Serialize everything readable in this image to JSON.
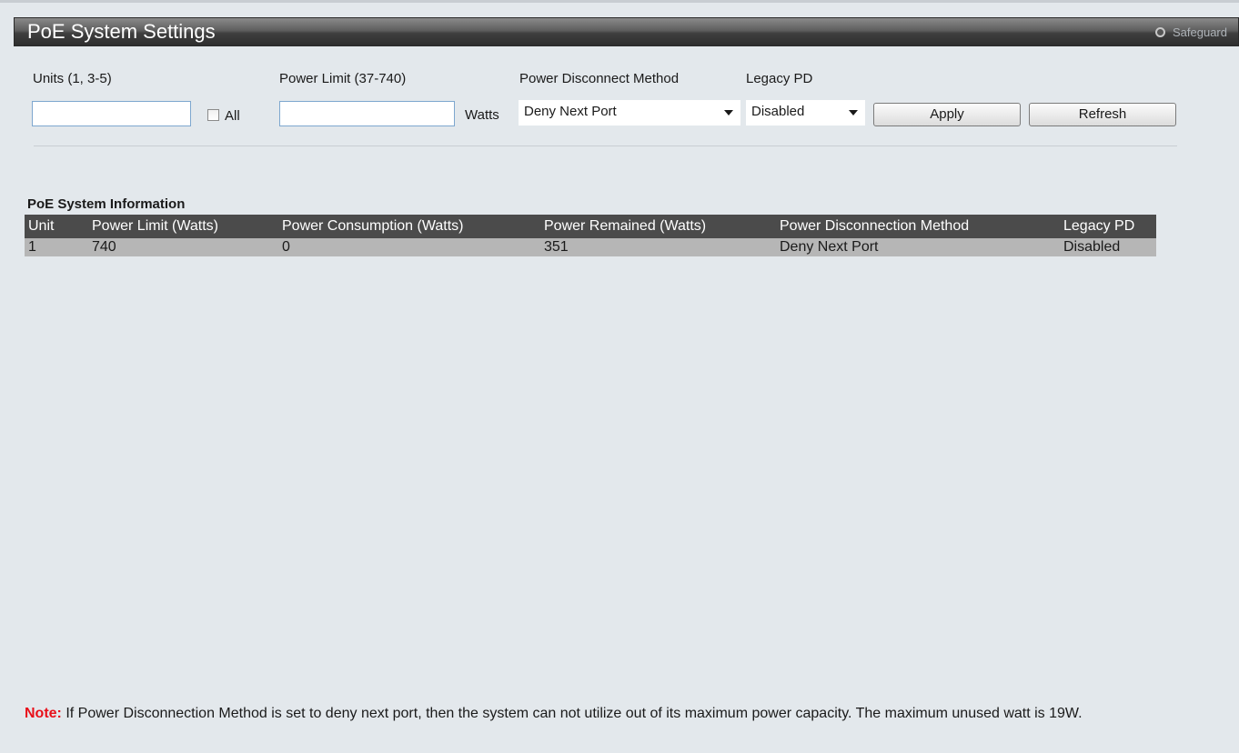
{
  "header": {
    "title": "PoE System Settings",
    "safeguard_label": "Safeguard"
  },
  "form": {
    "units_label": "Units (1, 3-5)",
    "units_value": "",
    "all_label": "All",
    "all_checked": false,
    "power_limit_label": "Power Limit (37-740)",
    "power_limit_value": "",
    "watts_label": "Watts",
    "disconnect_label": "Power Disconnect Method",
    "disconnect_value": "Deny Next Port",
    "legacy_label": "Legacy PD",
    "legacy_value": "Disabled",
    "apply_label": "Apply",
    "refresh_label": "Refresh"
  },
  "info": {
    "title": "PoE System Information",
    "columns": [
      "Unit",
      "Power Limit (Watts)",
      "Power Consumption (Watts)",
      "Power Remained (Watts)",
      "Power Disconnection Method",
      "Legacy PD"
    ],
    "rows": [
      [
        "1",
        "740",
        "0",
        "351",
        "Deny Next Port",
        "Disabled"
      ]
    ]
  },
  "note": {
    "label": "Note:",
    "text": " If Power Disconnection Method is set to deny next port, then the system can not utilize out of its maximum power capacity. The maximum unused watt is 19W."
  },
  "colors": {
    "note_label": "#e8101a",
    "table_header_bg": "#4b4b4b",
    "table_row_bg": "#b6b6b6",
    "page_bg": "#e3e8ec"
  }
}
